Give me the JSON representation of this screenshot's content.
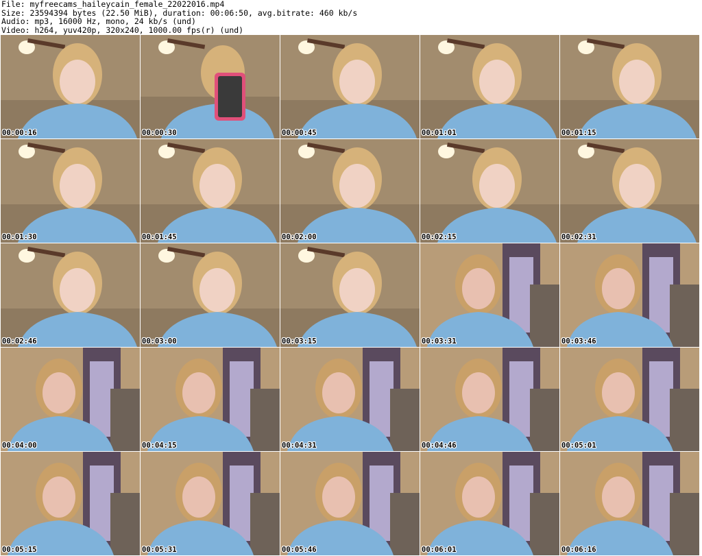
{
  "header": {
    "file": "File: myfreecams_haileycain_female_22022016.mp4",
    "size": "Size: 23594394 bytes (22.50 MiB), duration: 00:06:50, avg.bitrate: 460 kb/s",
    "audio": "Audio: mp3, 16000 Hz, mono, 24 kb/s (und)",
    "video": "Video: h264, yuv420p, 320x240, 1000.00 fps(r) (und)"
  },
  "thumbnails": [
    {
      "time": "00:00:16",
      "scene": "fan"
    },
    {
      "time": "00:00:30",
      "scene": "phone"
    },
    {
      "time": "00:00:45",
      "scene": "fan"
    },
    {
      "time": "00:01:01",
      "scene": "fan"
    },
    {
      "time": "00:01:15",
      "scene": "fan"
    },
    {
      "time": "00:01:30",
      "scene": "fan"
    },
    {
      "time": "00:01:45",
      "scene": "fan"
    },
    {
      "time": "00:02:00",
      "scene": "fan"
    },
    {
      "time": "00:02:15",
      "scene": "fan"
    },
    {
      "time": "00:02:31",
      "scene": "fan"
    },
    {
      "time": "00:02:46",
      "scene": "fan"
    },
    {
      "time": "00:03:00",
      "scene": "fan"
    },
    {
      "time": "00:03:15",
      "scene": "fan"
    },
    {
      "time": "00:03:31",
      "scene": "curtain"
    },
    {
      "time": "00:03:46",
      "scene": "curtain"
    },
    {
      "time": "00:04:00",
      "scene": "curtain"
    },
    {
      "time": "00:04:15",
      "scene": "curtain"
    },
    {
      "time": "00:04:31",
      "scene": "curtain"
    },
    {
      "time": "00:04:46",
      "scene": "curtain"
    },
    {
      "time": "00:05:01",
      "scene": "curtain"
    },
    {
      "time": "00:05:15",
      "scene": "curtain"
    },
    {
      "time": "00:05:31",
      "scene": "curtain"
    },
    {
      "time": "00:05:46",
      "scene": "curtain"
    },
    {
      "time": "00:06:01",
      "scene": "curtain"
    },
    {
      "time": "00:06:16",
      "scene": "curtain"
    }
  ]
}
